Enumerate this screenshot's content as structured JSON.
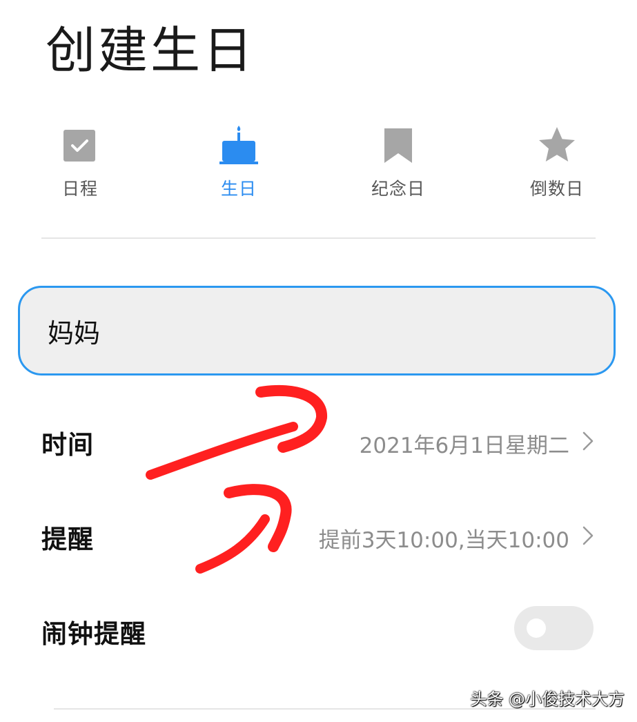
{
  "page": {
    "title": "创建生日"
  },
  "type_tabs": [
    {
      "label": "日程",
      "icon": "checkbox-icon",
      "active": false
    },
    {
      "label": "生日",
      "icon": "birthday-cake-icon",
      "active": true
    },
    {
      "label": "纪念日",
      "icon": "bookmark-icon",
      "active": false
    },
    {
      "label": "倒数日",
      "icon": "star-icon",
      "active": false
    }
  ],
  "name_input": {
    "value": "妈妈"
  },
  "time_row": {
    "label": "时间",
    "value": "2021年6月1日星期二"
  },
  "reminder_row": {
    "label": "提醒",
    "value": "提前3天10:00,当天10:00"
  },
  "alarm_row": {
    "label": "闹钟提醒",
    "enabled": false
  },
  "watermark": {
    "text": "头条 @小俊技术大方"
  },
  "colors": {
    "accent": "#2b8cf0",
    "inactive_icon": "#a6a6a6",
    "annotation_red": "#ff2020"
  }
}
